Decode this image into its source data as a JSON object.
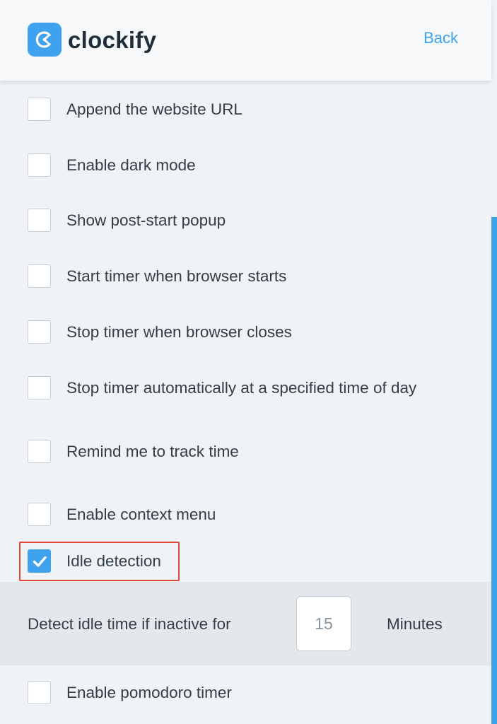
{
  "header": {
    "logo_text": "clockify",
    "back_label": "Back",
    "accent": "#3ea2ee"
  },
  "settings": [
    {
      "label": "Append the website URL",
      "checked": false
    },
    {
      "label": "Enable dark mode",
      "checked": false
    },
    {
      "label": "Show post-start popup",
      "checked": false
    },
    {
      "label": "Start timer when browser starts",
      "checked": false
    },
    {
      "label": "Stop timer when browser closes",
      "checked": false
    },
    {
      "label": "Stop timer automatically at a specified time of day",
      "checked": false
    },
    {
      "label": "Remind me to track time",
      "checked": false
    },
    {
      "label": "Enable context menu",
      "checked": false
    },
    {
      "label": "Idle detection",
      "checked": true
    },
    {
      "label": "Enable pomodoro timer",
      "checked": false
    }
  ],
  "idle": {
    "label": "Detect idle time if inactive for",
    "value": "15",
    "unit": "Minutes"
  },
  "icons": {
    "logo": "clockify-logo-icon",
    "check": "checkmark-icon"
  },
  "colors": {
    "highlight": "#e0463a",
    "scrollbar": "#3fa3ea"
  }
}
